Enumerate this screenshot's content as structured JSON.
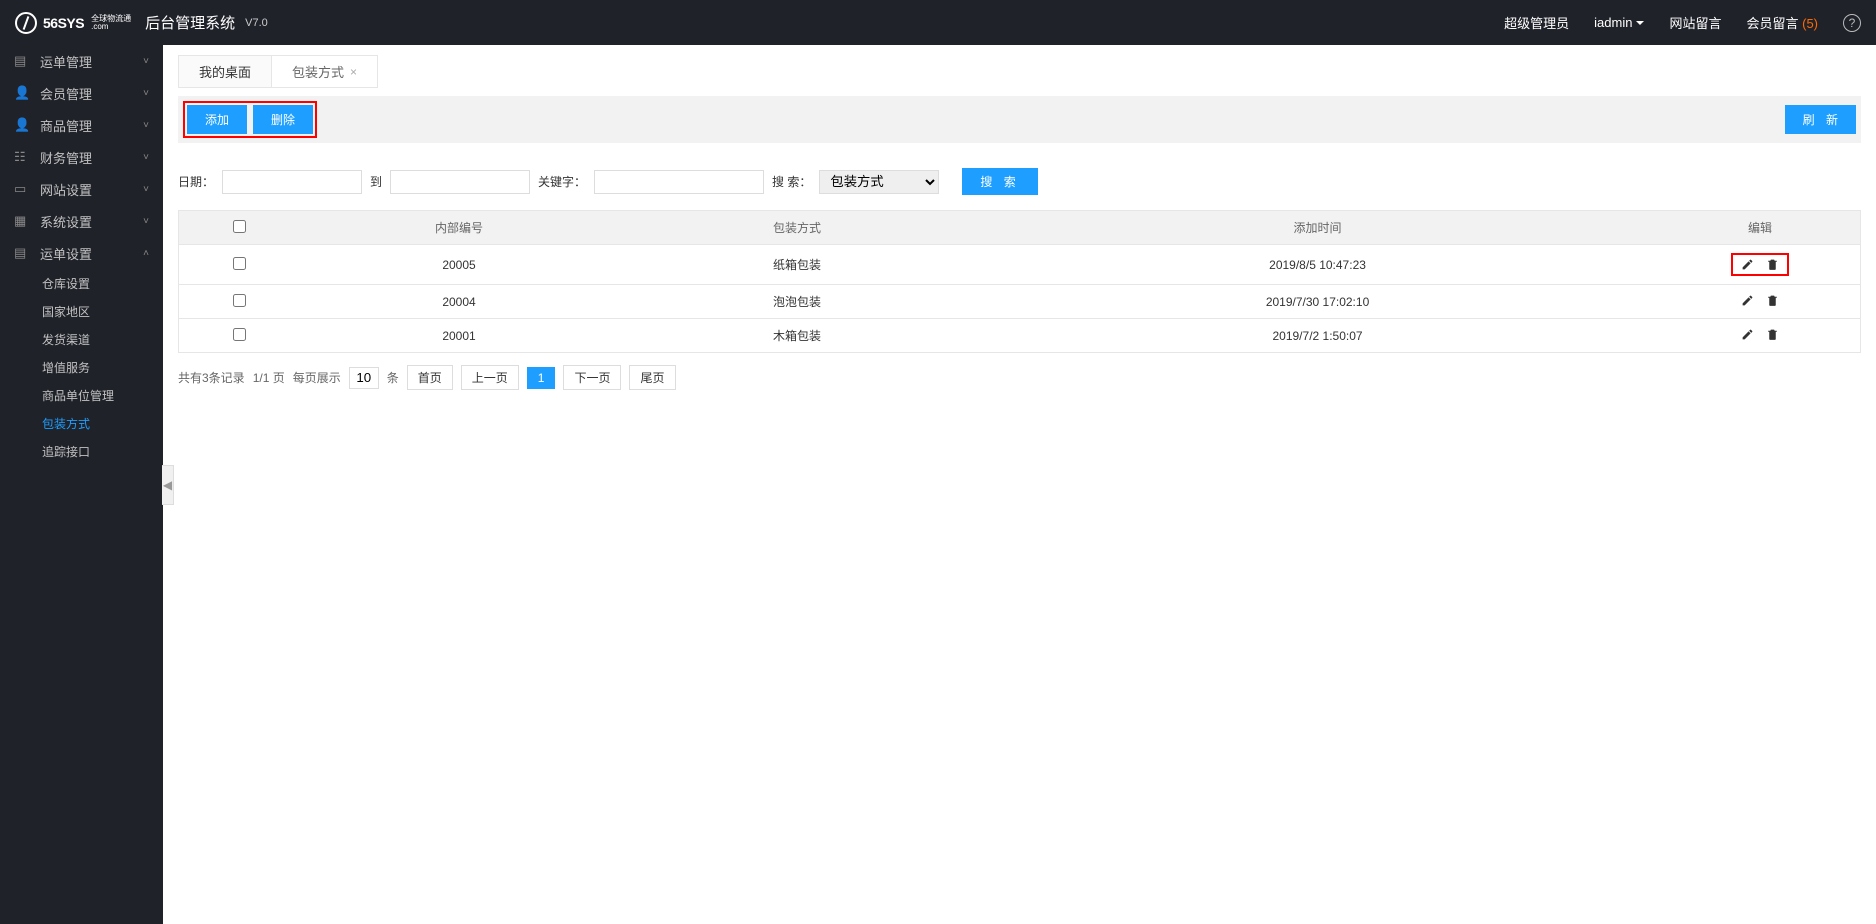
{
  "header": {
    "logo_main": "56SYS",
    "logo_sub1": "全球物流通",
    "logo_sub2": ".com",
    "app_title": "后台管理系统",
    "version": "V7.0",
    "role": "超级管理员",
    "user": "iadmin",
    "link_site_msg": "网站留言",
    "link_member_msg": "会员留言",
    "member_msg_count": "(5)"
  },
  "sidebar": {
    "items": [
      {
        "label": "运单管理",
        "icon": "doc"
      },
      {
        "label": "会员管理",
        "icon": "user"
      },
      {
        "label": "商品管理",
        "icon": "user"
      },
      {
        "label": "财务管理",
        "icon": "coins"
      },
      {
        "label": "网站设置",
        "icon": "layout"
      },
      {
        "label": "系统设置",
        "icon": "grid"
      },
      {
        "label": "运单设置",
        "icon": "doc",
        "expanded": true
      }
    ],
    "subs": [
      {
        "label": "仓库设置"
      },
      {
        "label": "国家地区"
      },
      {
        "label": "发货渠道"
      },
      {
        "label": "增值服务"
      },
      {
        "label": "商品单位管理"
      },
      {
        "label": "包装方式",
        "active": true
      },
      {
        "label": "追踪接口"
      }
    ]
  },
  "tabs": {
    "t1": "我的桌面",
    "t2": "包装方式"
  },
  "toolbar": {
    "add": "添加",
    "delete": "删除",
    "refresh": "刷 新"
  },
  "filters": {
    "date_label": "日期：",
    "to": "到",
    "keyword_label": "关键字：",
    "search_label": "搜 索：",
    "select_value": "包装方式",
    "search_btn": "搜 索"
  },
  "table": {
    "headers": {
      "code": "内部编号",
      "type": "包装方式",
      "time": "添加时间",
      "edit": "编辑"
    },
    "rows": [
      {
        "code": "20005",
        "type": "纸箱包装",
        "time": "2019/8/5 10:47:23",
        "highlight": true
      },
      {
        "code": "20004",
        "type": "泡泡包装",
        "time": "2019/7/30 17:02:10"
      },
      {
        "code": "20001",
        "type": "木箱包装",
        "time": "2019/7/2 1:50:07"
      }
    ]
  },
  "pager": {
    "summary": "共有3条记录",
    "pages": "1/1 页",
    "per_page_label": "每页展示",
    "per_page": "10",
    "unit": "条",
    "first": "首页",
    "prev": "上一页",
    "current": "1",
    "next": "下一页",
    "last": "尾页"
  }
}
